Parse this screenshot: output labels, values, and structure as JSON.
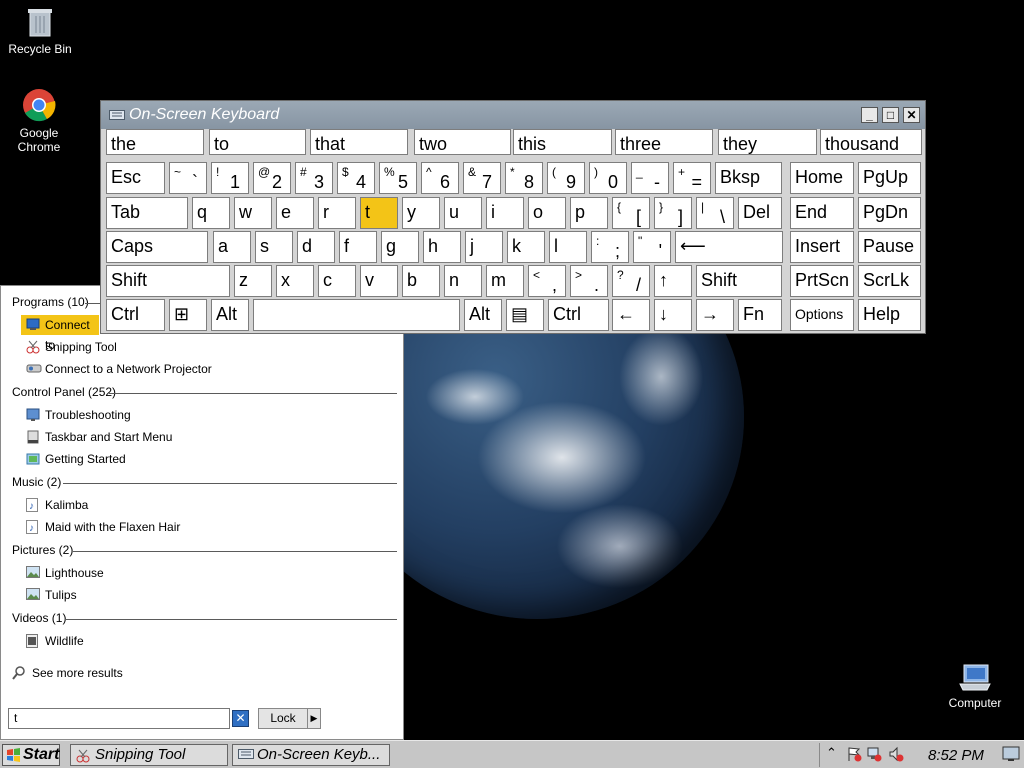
{
  "desktop": {
    "icons": [
      {
        "label": "Recycle Bin",
        "icon": "recycle-bin-icon"
      },
      {
        "label": "Google Chrome",
        "icon": "chrome-icon"
      },
      {
        "label": "Computer",
        "icon": "computer-icon"
      }
    ]
  },
  "osk": {
    "title": "On-Screen Keyboard",
    "predictions": [
      "the",
      "to",
      "that",
      "two",
      "this",
      "three",
      "they",
      "thousand"
    ],
    "row1": [
      {
        "main": "Esc"
      },
      {
        "sub": "~",
        "main": "`"
      },
      {
        "sub": "!",
        "main": "1"
      },
      {
        "sub": "@",
        "main": "2"
      },
      {
        "sub": "#",
        "main": "3"
      },
      {
        "sub": "$",
        "main": "4"
      },
      {
        "sub": "%",
        "main": "5"
      },
      {
        "sub": "^",
        "main": "6"
      },
      {
        "sub": "&",
        "main": "7"
      },
      {
        "sub": "*",
        "main": "8"
      },
      {
        "sub": "(",
        "main": "9"
      },
      {
        "sub": ")",
        "main": "0"
      },
      {
        "sub": "_",
        "main": "-"
      },
      {
        "sub": "+",
        "main": "="
      },
      {
        "main": "Bksp"
      },
      {
        "main": "Home"
      },
      {
        "main": "PgUp"
      }
    ],
    "row2": [
      {
        "main": "Tab"
      },
      {
        "main": "q"
      },
      {
        "main": "w"
      },
      {
        "main": "e"
      },
      {
        "main": "r"
      },
      {
        "main": "t"
      },
      {
        "main": "y"
      },
      {
        "main": "u"
      },
      {
        "main": "i"
      },
      {
        "main": "o"
      },
      {
        "main": "p"
      },
      {
        "sub": "{",
        "main": "["
      },
      {
        "sub": "}",
        "main": "]"
      },
      {
        "sub": "|",
        "main": "\\"
      },
      {
        "main": "Del"
      },
      {
        "main": "End"
      },
      {
        "main": "PgDn"
      }
    ],
    "row3": [
      {
        "main": "Caps"
      },
      {
        "main": "a"
      },
      {
        "main": "s"
      },
      {
        "main": "d"
      },
      {
        "main": "f"
      },
      {
        "main": "g"
      },
      {
        "main": "h"
      },
      {
        "main": "j"
      },
      {
        "main": "k"
      },
      {
        "main": "l"
      },
      {
        "sub": ":",
        "main": ";"
      },
      {
        "sub": "\"",
        "main": "'"
      },
      {
        "main": "⟵"
      },
      {
        "main": "Insert"
      },
      {
        "main": "Pause"
      }
    ],
    "row4": [
      {
        "main": "Shift"
      },
      {
        "main": "z"
      },
      {
        "main": "x"
      },
      {
        "main": "c"
      },
      {
        "main": "v"
      },
      {
        "main": "b"
      },
      {
        "main": "n"
      },
      {
        "main": "m"
      },
      {
        "sub": "<",
        "main": ","
      },
      {
        "sub": ">",
        "main": "."
      },
      {
        "sub": "?",
        "main": "/"
      },
      {
        "main": "↑"
      },
      {
        "main": "Shift"
      },
      {
        "main": "PrtScn"
      },
      {
        "main": "ScrLk"
      }
    ],
    "row5": [
      {
        "main": "Ctrl"
      },
      {
        "main": "⊞"
      },
      {
        "main": "Alt"
      },
      {
        "main": ""
      },
      {
        "main": "Alt"
      },
      {
        "main": "▤"
      },
      {
        "main": "Ctrl"
      },
      {
        "main": "←"
      },
      {
        "main": "↓"
      },
      {
        "main": "→"
      },
      {
        "main": "Fn"
      },
      {
        "main": "Options"
      },
      {
        "main": "Help"
      }
    ],
    "highlighted_key": "t"
  },
  "startmenu": {
    "categories": {
      "programs": "Programs (10)",
      "control": "Control Panel (252)",
      "music": "Music (2)",
      "pictures": "Pictures (2)",
      "videos": "Videos (1)"
    },
    "programs": [
      "Connect to",
      "Snipping Tool",
      "Connect to a Network Projector"
    ],
    "control": [
      "Troubleshooting",
      "Taskbar and Start Menu",
      "Getting Started"
    ],
    "music": [
      "Kalimba",
      "Maid with the Flaxen Hair"
    ],
    "pictures": [
      "Lighthouse",
      "Tulips"
    ],
    "videos": [
      "Wildlife"
    ],
    "see_more": "See more results",
    "search_value": "t",
    "lock_label": "Lock"
  },
  "taskbar": {
    "start_label": "Start",
    "tasks": [
      "Snipping Tool",
      "On-Screen Keyb..."
    ],
    "clock": "8:52 PM"
  },
  "colors": {
    "highlight": "#f3c417",
    "titlebar": "#8f9dab",
    "desktop": "#000000"
  }
}
